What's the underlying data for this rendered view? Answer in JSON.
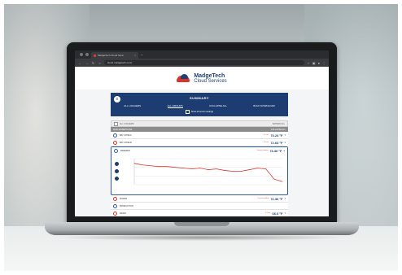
{
  "browser": {
    "tab_title": "MadgeTech Cloud Servi",
    "new_tab": "+",
    "address": "cloud.madgetech.com/",
    "nav": {
      "back": "←",
      "forward": "→",
      "reload": "↻",
      "home": "⌂"
    },
    "toolbar_icons": [
      "star-icon",
      "extensions-icon",
      "profile-icon",
      "menu-icon"
    ]
  },
  "brand": {
    "name": "MadgeTech",
    "sub": "Cloud Services",
    "colors": {
      "red": "#d9342b",
      "navy": "#1d3f73"
    }
  },
  "summary": {
    "title": "SUMMARY",
    "links": [
      "ALL LOGGERS",
      "ALL GROUPS",
      "COLLAPSE ALL",
      "BULK DOWNLOAD"
    ],
    "rollover": "Show all recent readings"
  },
  "list": {
    "header_label": "ALL LOGGERS",
    "header_right": "EXPAND ALL",
    "group_label": "MAIN WAREHOUSE",
    "group_right": "COLLAPSE ALL",
    "rows": [
      {
        "name": "BAY ZONE A",
        "meta": "5.7 sec",
        "value": "73.24 °F",
        "tail": "▾"
      },
      {
        "name": "BAY ZONE B",
        "meta": "6.1 sec",
        "value": "72.64 °F",
        "tail": "▾"
      }
    ],
    "expanded": {
      "name": "FREEZER",
      "meta": "Current reading",
      "value": "73.36 °F",
      "tail": "▴"
    },
    "rows_after": [
      {
        "name": "RH2000",
        "meta": "Current reading",
        "value": "72.36 °F",
        "tail": "▾"
      },
      {
        "name": "PRODUCTION",
        "meta": "",
        "value": "",
        "tail": ""
      },
      {
        "name": "DRAIN",
        "meta": "4.2 sec",
        "value": "66.6 °F",
        "tail": "▾"
      }
    ]
  },
  "chart_data": {
    "type": "line",
    "series": [
      {
        "values": [
          75.2,
          75.0,
          74.9,
          74.8,
          74.8,
          74.7,
          74.6,
          74.5,
          74.6,
          74.4,
          74.5,
          74.3,
          74.2,
          74.2,
          74.4,
          74.6,
          74.5,
          73.2,
          72.9
        ]
      }
    ],
    "ylim": [
      72.5,
      75.8
    ],
    "grid": true,
    "line_color": "#d9342b"
  }
}
